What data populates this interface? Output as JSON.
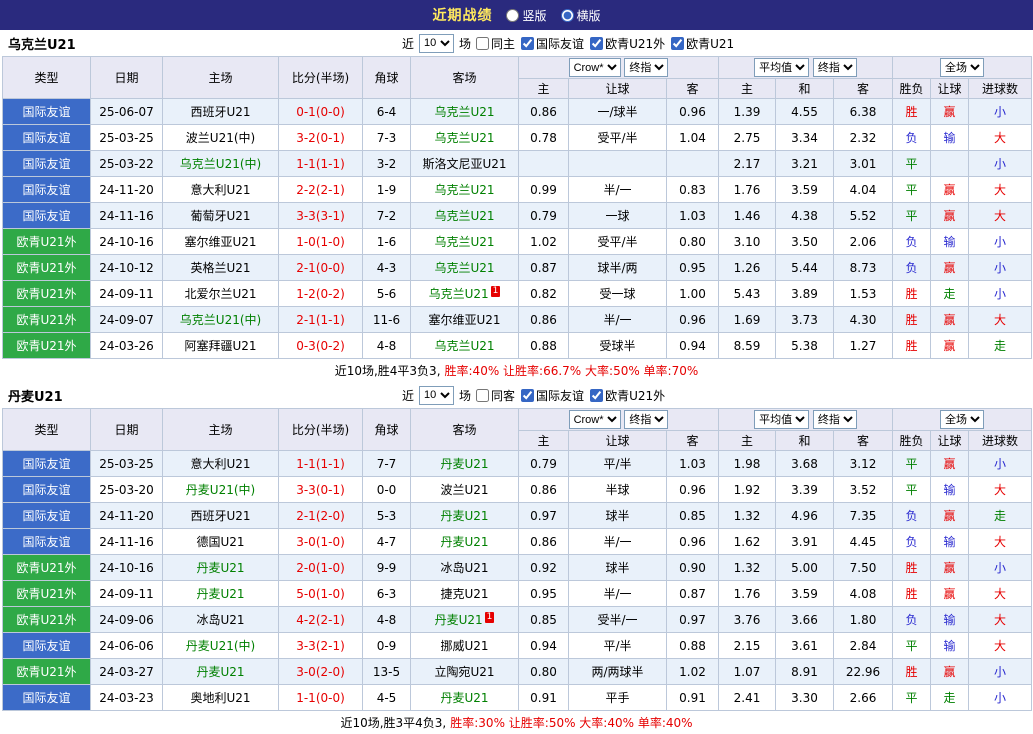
{
  "topbar": {
    "title": "近期战绩",
    "options": [
      {
        "label": "竖版",
        "selected": false
      },
      {
        "label": "横版",
        "selected": true
      }
    ]
  },
  "table_header": {
    "type": "类型",
    "date": "日期",
    "home": "主场",
    "score": "比分(半场)",
    "corner": "角球",
    "away": "客场",
    "group1_select_a": "Crow*",
    "group1_select_b": "终指",
    "g1_home": "主",
    "g1_handicap": "让球",
    "g1_away": "客",
    "group2_select_a": "平均值",
    "group2_select_b": "终指",
    "g2_home": "主",
    "g2_draw": "和",
    "g2_away": "客",
    "group3_select": "全场",
    "g3_result": "胜负",
    "g3_handicap": "让球",
    "g3_goals": "进球数"
  },
  "sections": [
    {
      "team": "乌克兰U21",
      "filter": {
        "near_label": "近",
        "count": "10",
        "matches_label": "场",
        "checkboxes": [
          {
            "label": "同主",
            "checked": false
          },
          {
            "label": "国际友谊",
            "checked": true
          },
          {
            "label": "欧青U21外",
            "checked": true
          },
          {
            "label": "欧青U21",
            "checked": true
          }
        ]
      },
      "rows": [
        {
          "type": "国际友谊",
          "type_color": "blue",
          "date": "25-06-07",
          "home": "西班牙U21",
          "home_subject": false,
          "score": "0-1(0-0)",
          "corner": "6-4",
          "away": "乌克兰U21",
          "away_subject": true,
          "away_badge": "",
          "odds": [
            "0.86",
            "一/球半",
            "0.96"
          ],
          "avg": [
            "1.39",
            "4.55",
            "6.38"
          ],
          "result": [
            {
              "t": "胜",
              "c": "red"
            },
            {
              "t": "赢",
              "c": "red"
            },
            {
              "t": "小",
              "c": "blue"
            }
          ]
        },
        {
          "type": "国际友谊",
          "type_color": "blue",
          "date": "25-03-25",
          "home": "波兰U21(中)",
          "home_subject": false,
          "score": "3-2(0-1)",
          "corner": "7-3",
          "away": "乌克兰U21",
          "away_subject": true,
          "away_badge": "",
          "odds": [
            "0.78",
            "受平/半",
            "1.04"
          ],
          "avg": [
            "2.75",
            "3.34",
            "2.32"
          ],
          "result": [
            {
              "t": "负",
              "c": "blue"
            },
            {
              "t": "输",
              "c": "blue"
            },
            {
              "t": "大",
              "c": "red"
            }
          ]
        },
        {
          "type": "国际友谊",
          "type_color": "blue",
          "date": "25-03-22",
          "home": "乌克兰U21(中)",
          "home_subject": true,
          "score": "1-1(1-1)",
          "corner": "3-2",
          "away": "斯洛文尼亚U21",
          "away_subject": false,
          "away_badge": "",
          "odds": [
            "",
            "",
            ""
          ],
          "avg": [
            "2.17",
            "3.21",
            "3.01"
          ],
          "result": [
            {
              "t": "平",
              "c": "green"
            },
            {
              "t": "",
              "c": ""
            },
            {
              "t": "小",
              "c": "blue"
            }
          ]
        },
        {
          "type": "国际友谊",
          "type_color": "blue",
          "date": "24-11-20",
          "home": "意大利U21",
          "home_subject": false,
          "score": "2-2(2-1)",
          "corner": "1-9",
          "away": "乌克兰U21",
          "away_subject": true,
          "away_badge": "",
          "odds": [
            "0.99",
            "半/一",
            "0.83"
          ],
          "avg": [
            "1.76",
            "3.59",
            "4.04"
          ],
          "result": [
            {
              "t": "平",
              "c": "green"
            },
            {
              "t": "赢",
              "c": "red"
            },
            {
              "t": "大",
              "c": "red"
            }
          ]
        },
        {
          "type": "国际友谊",
          "type_color": "blue",
          "date": "24-11-16",
          "home": "葡萄牙U21",
          "home_subject": false,
          "score": "3-3(3-1)",
          "corner": "7-2",
          "away": "乌克兰U21",
          "away_subject": true,
          "away_badge": "",
          "odds": [
            "0.79",
            "一球",
            "1.03"
          ],
          "avg": [
            "1.46",
            "4.38",
            "5.52"
          ],
          "result": [
            {
              "t": "平",
              "c": "green"
            },
            {
              "t": "赢",
              "c": "red"
            },
            {
              "t": "大",
              "c": "red"
            }
          ]
        },
        {
          "type": "欧青U21外",
          "type_color": "green",
          "date": "24-10-16",
          "home": "塞尔维亚U21",
          "home_subject": false,
          "score": "1-0(1-0)",
          "corner": "1-6",
          "away": "乌克兰U21",
          "away_subject": true,
          "away_badge": "",
          "odds": [
            "1.02",
            "受平/半",
            "0.80"
          ],
          "avg": [
            "3.10",
            "3.50",
            "2.06"
          ],
          "result": [
            {
              "t": "负",
              "c": "blue"
            },
            {
              "t": "输",
              "c": "blue"
            },
            {
              "t": "小",
              "c": "blue"
            }
          ]
        },
        {
          "type": "欧青U21外",
          "type_color": "green",
          "date": "24-10-12",
          "home": "英格兰U21",
          "home_subject": false,
          "score": "2-1(0-0)",
          "corner": "4-3",
          "away": "乌克兰U21",
          "away_subject": true,
          "away_badge": "",
          "odds": [
            "0.87",
            "球半/两",
            "0.95"
          ],
          "avg": [
            "1.26",
            "5.44",
            "8.73"
          ],
          "result": [
            {
              "t": "负",
              "c": "blue"
            },
            {
              "t": "赢",
              "c": "red"
            },
            {
              "t": "小",
              "c": "blue"
            }
          ]
        },
        {
          "type": "欧青U21外",
          "type_color": "green",
          "date": "24-09-11",
          "home": "北爱尔兰U21",
          "home_subject": false,
          "score": "1-2(0-2)",
          "corner": "5-6",
          "away": "乌克兰U21",
          "away_subject": true,
          "away_badge": "1",
          "odds": [
            "0.82",
            "受一球",
            "1.00"
          ],
          "avg": [
            "5.43",
            "3.89",
            "1.53"
          ],
          "result": [
            {
              "t": "胜",
              "c": "red"
            },
            {
              "t": "走",
              "c": "green"
            },
            {
              "t": "小",
              "c": "blue"
            }
          ]
        },
        {
          "type": "欧青U21外",
          "type_color": "green",
          "date": "24-09-07",
          "home": "乌克兰U21(中)",
          "home_subject": true,
          "score": "2-1(1-1)",
          "corner": "11-6",
          "away": "塞尔维亚U21",
          "away_subject": false,
          "away_badge": "",
          "odds": [
            "0.86",
            "半/一",
            "0.96"
          ],
          "avg": [
            "1.69",
            "3.73",
            "4.30"
          ],
          "result": [
            {
              "t": "胜",
              "c": "red"
            },
            {
              "t": "赢",
              "c": "red"
            },
            {
              "t": "大",
              "c": "red"
            }
          ]
        },
        {
          "type": "欧青U21外",
          "type_color": "green",
          "date": "24-03-26",
          "home": "阿塞拜疆U21",
          "home_subject": false,
          "score": "0-3(0-2)",
          "corner": "4-8",
          "away": "乌克兰U21",
          "away_subject": true,
          "away_badge": "",
          "odds": [
            "0.88",
            "受球半",
            "0.94"
          ],
          "avg": [
            "8.59",
            "5.38",
            "1.27"
          ],
          "result": [
            {
              "t": "胜",
              "c": "red"
            },
            {
              "t": "赢",
              "c": "red"
            },
            {
              "t": "走",
              "c": "green"
            }
          ]
        }
      ],
      "summary_black": "近10场,胜4平3负3,",
      "summary_red": "胜率:40% 让胜率:66.7% 大率:50% 单率:70%"
    },
    {
      "team": "丹麦U21",
      "filter": {
        "near_label": "近",
        "count": "10",
        "matches_label": "场",
        "checkboxes": [
          {
            "label": "同客",
            "checked": false
          },
          {
            "label": "国际友谊",
            "checked": true
          },
          {
            "label": "欧青U21外",
            "checked": true
          }
        ]
      },
      "rows": [
        {
          "type": "国际友谊",
          "type_color": "blue",
          "date": "25-03-25",
          "home": "意大利U21",
          "home_subject": false,
          "score": "1-1(1-1)",
          "corner": "7-7",
          "away": "丹麦U21",
          "away_subject": true,
          "away_badge": "",
          "odds": [
            "0.79",
            "平/半",
            "1.03"
          ],
          "avg": [
            "1.98",
            "3.68",
            "3.12"
          ],
          "result": [
            {
              "t": "平",
              "c": "green"
            },
            {
              "t": "赢",
              "c": "red"
            },
            {
              "t": "小",
              "c": "blue"
            }
          ]
        },
        {
          "type": "国际友谊",
          "type_color": "blue",
          "date": "25-03-20",
          "home": "丹麦U21(中)",
          "home_subject": true,
          "score": "3-3(0-1)",
          "corner": "0-0",
          "away": "波兰U21",
          "away_subject": false,
          "away_badge": "",
          "odds": [
            "0.86",
            "半球",
            "0.96"
          ],
          "avg": [
            "1.92",
            "3.39",
            "3.52"
          ],
          "result": [
            {
              "t": "平",
              "c": "green"
            },
            {
              "t": "输",
              "c": "blue"
            },
            {
              "t": "大",
              "c": "red"
            }
          ]
        },
        {
          "type": "国际友谊",
          "type_color": "blue",
          "date": "24-11-20",
          "home": "西班牙U21",
          "home_subject": false,
          "score": "2-1(2-0)",
          "corner": "5-3",
          "away": "丹麦U21",
          "away_subject": true,
          "away_badge": "",
          "odds": [
            "0.97",
            "球半",
            "0.85"
          ],
          "avg": [
            "1.32",
            "4.96",
            "7.35"
          ],
          "result": [
            {
              "t": "负",
              "c": "blue"
            },
            {
              "t": "赢",
              "c": "red"
            },
            {
              "t": "走",
              "c": "green"
            }
          ]
        },
        {
          "type": "国际友谊",
          "type_color": "blue",
          "date": "24-11-16",
          "home": "德国U21",
          "home_subject": false,
          "score": "3-0(1-0)",
          "corner": "4-7",
          "away": "丹麦U21",
          "away_subject": true,
          "away_badge": "",
          "odds": [
            "0.86",
            "半/一",
            "0.96"
          ],
          "avg": [
            "1.62",
            "3.91",
            "4.45"
          ],
          "result": [
            {
              "t": "负",
              "c": "blue"
            },
            {
              "t": "输",
              "c": "blue"
            },
            {
              "t": "大",
              "c": "red"
            }
          ]
        },
        {
          "type": "欧青U21外",
          "type_color": "green",
          "date": "24-10-16",
          "home": "丹麦U21",
          "home_subject": true,
          "score": "2-0(1-0)",
          "corner": "9-9",
          "away": "冰岛U21",
          "away_subject": false,
          "away_badge": "",
          "odds": [
            "0.92",
            "球半",
            "0.90"
          ],
          "avg": [
            "1.32",
            "5.00",
            "7.50"
          ],
          "result": [
            {
              "t": "胜",
              "c": "red"
            },
            {
              "t": "赢",
              "c": "red"
            },
            {
              "t": "小",
              "c": "blue"
            }
          ]
        },
        {
          "type": "欧青U21外",
          "type_color": "green",
          "date": "24-09-11",
          "home": "丹麦U21",
          "home_subject": true,
          "score": "5-0(1-0)",
          "corner": "6-3",
          "away": "捷克U21",
          "away_subject": false,
          "away_badge": "",
          "odds": [
            "0.95",
            "半/一",
            "0.87"
          ],
          "avg": [
            "1.76",
            "3.59",
            "4.08"
          ],
          "result": [
            {
              "t": "胜",
              "c": "red"
            },
            {
              "t": "赢",
              "c": "red"
            },
            {
              "t": "大",
              "c": "red"
            }
          ]
        },
        {
          "type": "欧青U21外",
          "type_color": "green",
          "date": "24-09-06",
          "home": "冰岛U21",
          "home_subject": false,
          "score": "4-2(2-1)",
          "corner": "4-8",
          "away": "丹麦U21",
          "away_subject": true,
          "away_badge": "1",
          "odds": [
            "0.85",
            "受半/一",
            "0.97"
          ],
          "avg": [
            "3.76",
            "3.66",
            "1.80"
          ],
          "result": [
            {
              "t": "负",
              "c": "blue"
            },
            {
              "t": "输",
              "c": "blue"
            },
            {
              "t": "大",
              "c": "red"
            }
          ]
        },
        {
          "type": "国际友谊",
          "type_color": "blue",
          "date": "24-06-06",
          "home": "丹麦U21(中)",
          "home_subject": true,
          "score": "3-3(2-1)",
          "corner": "0-9",
          "away": "挪威U21",
          "away_subject": false,
          "away_badge": "",
          "odds": [
            "0.94",
            "平/半",
            "0.88"
          ],
          "avg": [
            "2.15",
            "3.61",
            "2.84"
          ],
          "result": [
            {
              "t": "平",
              "c": "green"
            },
            {
              "t": "输",
              "c": "blue"
            },
            {
              "t": "大",
              "c": "red"
            }
          ]
        },
        {
          "type": "欧青U21外",
          "type_color": "green",
          "date": "24-03-27",
          "home": "丹麦U21",
          "home_subject": true,
          "score": "3-0(2-0)",
          "corner": "13-5",
          "away": "立陶宛U21",
          "away_subject": false,
          "away_badge": "",
          "odds": [
            "0.80",
            "两/两球半",
            "1.02"
          ],
          "avg": [
            "1.07",
            "8.91",
            "22.96"
          ],
          "result": [
            {
              "t": "胜",
              "c": "red"
            },
            {
              "t": "赢",
              "c": "red"
            },
            {
              "t": "小",
              "c": "blue"
            }
          ]
        },
        {
          "type": "国际友谊",
          "type_color": "blue",
          "date": "24-03-23",
          "home": "奥地利U21",
          "home_subject": false,
          "score": "1-1(0-0)",
          "corner": "4-5",
          "away": "丹麦U21",
          "away_subject": true,
          "away_badge": "",
          "odds": [
            "0.91",
            "平手",
            "0.91"
          ],
          "avg": [
            "2.41",
            "3.30",
            "2.66"
          ],
          "result": [
            {
              "t": "平",
              "c": "green"
            },
            {
              "t": "走",
              "c": "green"
            },
            {
              "t": "小",
              "c": "blue"
            }
          ]
        }
      ],
      "summary_black": "近10场,胜3平4负3,",
      "summary_red": "胜率:30% 让胜率:50% 大率:40% 单率:40%"
    }
  ]
}
